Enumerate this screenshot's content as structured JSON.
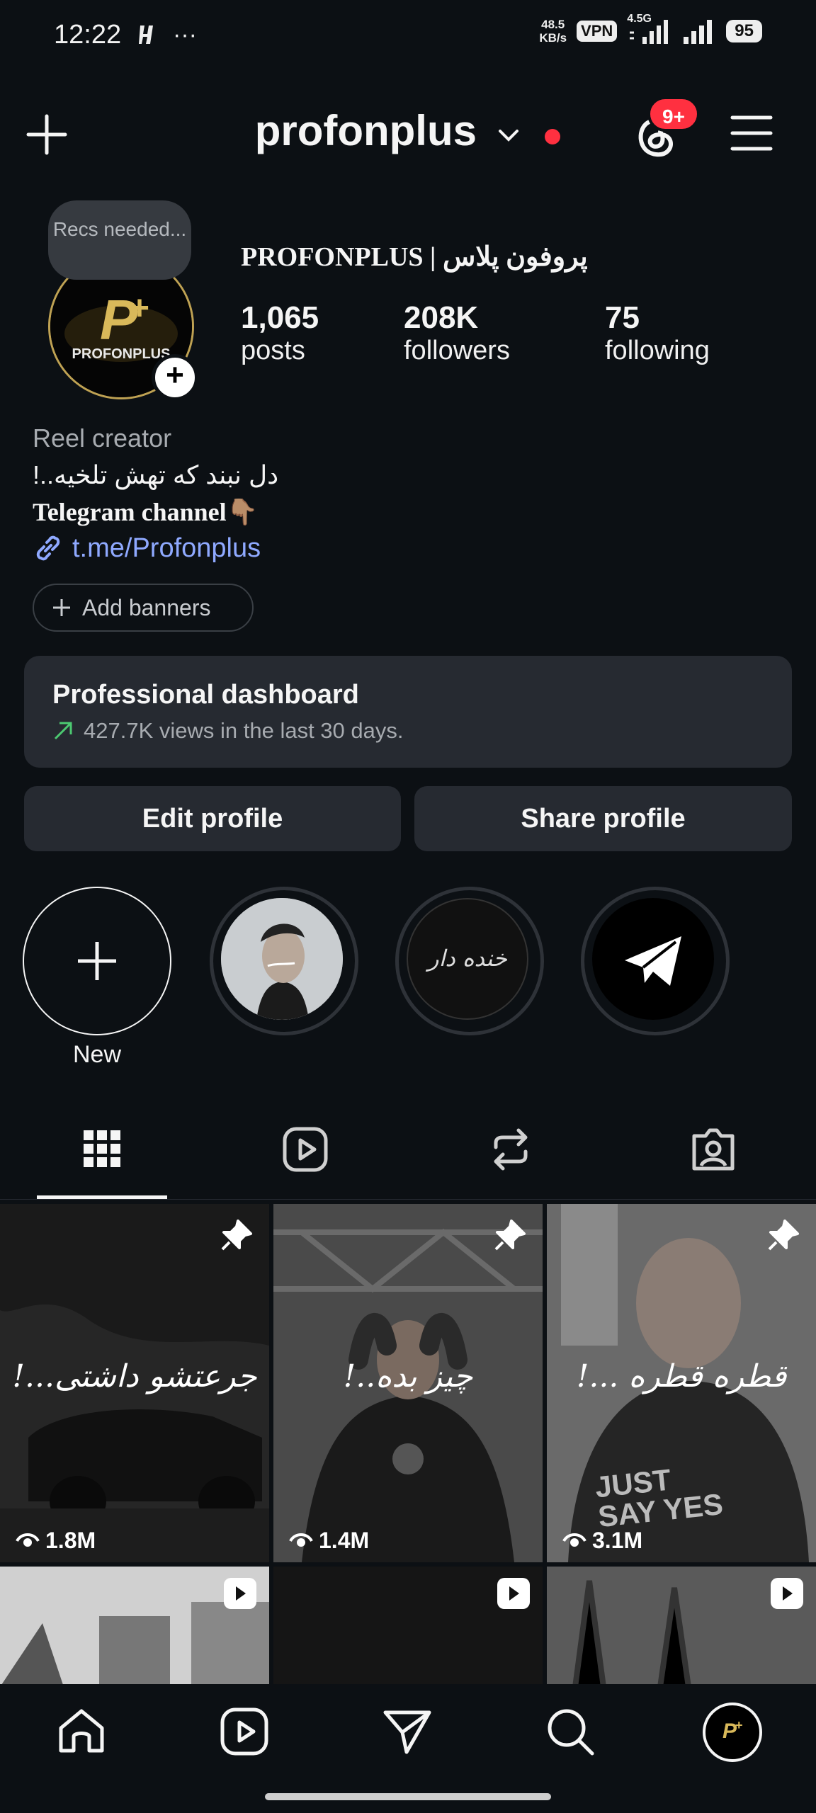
{
  "status": {
    "time": "12:22",
    "net_speed_top": "48.5",
    "net_speed_bottom": "KB/s",
    "vpn": "VPN",
    "network": "4.5G",
    "battery": "95"
  },
  "header": {
    "username": "profonplus",
    "notifications_badge": "9+"
  },
  "profile": {
    "recs_note": "Recs needed...",
    "avatar_text": "PROFONPLUS",
    "display_name": "PROFONPLUS | پروفون پلاس",
    "stats": [
      {
        "value": "1,065",
        "label": "posts"
      },
      {
        "value": "208K",
        "label": "followers"
      },
      {
        "value": "75",
        "label": "following"
      }
    ],
    "category": "Reel creator",
    "bio_line1": "دل نبند که تهش تلخیه..!",
    "bio_line2": "Telegram channel👇🏽",
    "link": "t.me/Profonplus",
    "add_banners": "Add banners"
  },
  "dashboard": {
    "title": "Professional dashboard",
    "subtitle": "427.7K views in the last 30 days."
  },
  "actions": {
    "edit": "Edit profile",
    "share": "Share profile"
  },
  "highlights": {
    "new_label": "New",
    "item2_text": "خنده دار"
  },
  "posts": [
    {
      "views": "1.8M",
      "caption": "جرعتشو داشتی...!",
      "pinned": true
    },
    {
      "views": "1.4M",
      "caption": "چیز بده..!",
      "pinned": true
    },
    {
      "views": "3.1M",
      "caption": "قطره قطره ...!",
      "pinned": true,
      "shirt_text": "JUST SAY YES"
    }
  ],
  "colors": {
    "background": "#0c1014",
    "card": "#262a31",
    "link": "#8fa9ff",
    "badge": "#ff3040",
    "avatar_gold": "#bfa253"
  },
  "icons": {
    "header": [
      "plus-icon",
      "chevron-down-icon",
      "threads-icon",
      "menu-icon"
    ],
    "tabs": [
      "grid-icon",
      "reels-icon",
      "reposts-icon",
      "tagged-icon"
    ],
    "nav": [
      "home-icon",
      "reels-icon",
      "send-icon",
      "search-icon",
      "profile-avatar"
    ]
  }
}
